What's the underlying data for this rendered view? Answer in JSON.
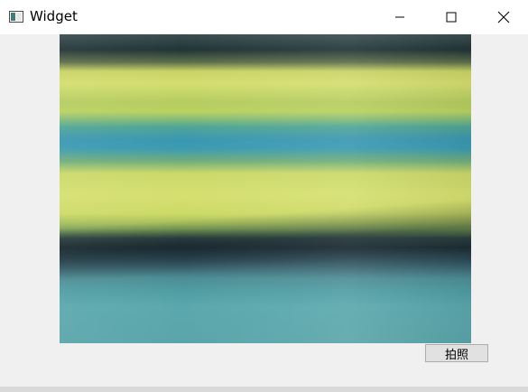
{
  "window": {
    "title": "Widget",
    "app_icon": "window-app-icon",
    "controls": {
      "minimize_icon": "minimize-icon",
      "maximize_icon": "maximize-icon",
      "close_icon": "close-icon"
    }
  },
  "main": {
    "camera_view": "camera-preview",
    "capture_button_label": "拍照"
  }
}
